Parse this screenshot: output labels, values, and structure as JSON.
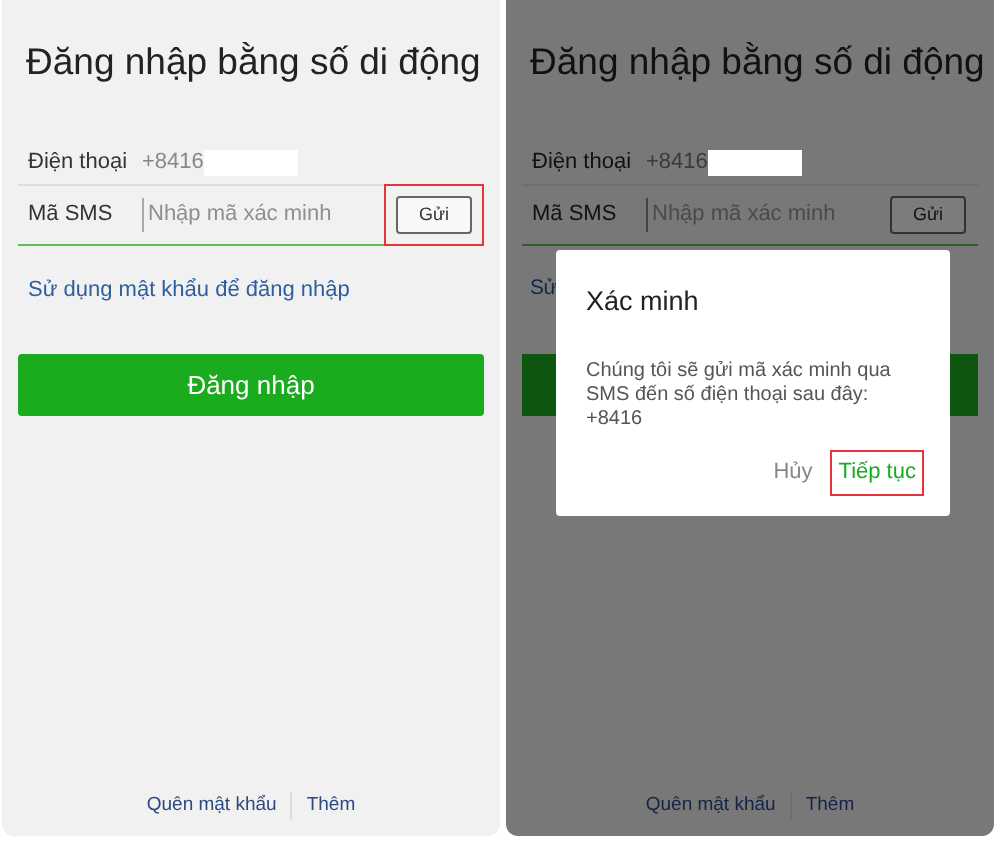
{
  "panels": [
    {
      "title": "Đăng nhập bằng số di động",
      "phone": {
        "label": "Điện thoại",
        "value": "+8416"
      },
      "sms": {
        "label": "Mã SMS",
        "placeholder": "Nhập mã xác minh",
        "button": {
          "label": "Gửi",
          "highlighted": true
        }
      },
      "password_link": "Sử dụng mật khẩu để đăng nhập",
      "login_label": "Đăng nhập",
      "footer_links": [
        "Quên mật khẩu",
        "Thêm"
      ]
    },
    {
      "title": "Đăng nhập bằng số di động",
      "phone": {
        "label": "Điện thoại",
        "value": "+8416"
      },
      "sms": {
        "label": "Mã SMS",
        "placeholder": "Nhập mã xác minh",
        "button": {
          "label": "Gửi",
          "highlighted": false
        }
      },
      "password_link": "Sử",
      "footer_links": [
        "Quên mật khẩu",
        "Thêm"
      ],
      "dialog": {
        "title": "Xác minh",
        "message": "Chúng tôi sẽ gửi mã xác minh qua SMS đến số điện thoại sau đây: +8416",
        "buttons": [
          {
            "label": "Hủy",
            "kind": "cancel",
            "highlighted": false
          },
          {
            "label": "Tiếp tục",
            "kind": "confirm",
            "highlighted": true
          }
        ]
      }
    }
  ]
}
